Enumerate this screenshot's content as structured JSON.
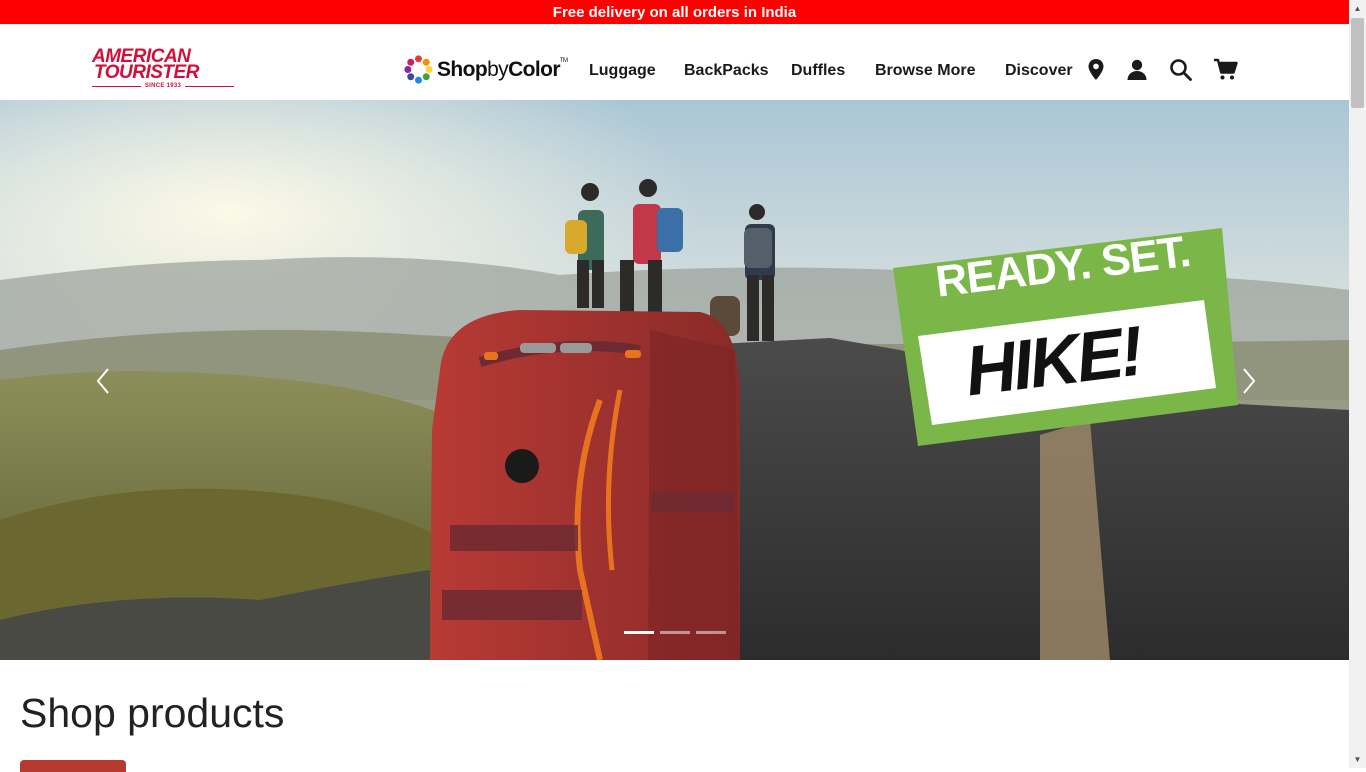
{
  "promo_bar": {
    "text": "Free delivery on all orders in India"
  },
  "header": {
    "logo": {
      "line1": "AMERICAN",
      "line2": "TOURISTER",
      "since": "SINCE 1933"
    },
    "shop_by_color": {
      "shop": "Shop",
      "by": "by",
      "color": "Color",
      "tm": "TM"
    },
    "nav": [
      {
        "label": "Luggage"
      },
      {
        "label": "BackPacks"
      },
      {
        "label": "Duffles"
      },
      {
        "label": "Browse More"
      },
      {
        "label": "Discover"
      }
    ],
    "icons": [
      "location-pin-icon",
      "user-account-icon",
      "search-icon",
      "shopping-cart-icon"
    ]
  },
  "hero": {
    "badge_top": "READY. SET.",
    "badge_bottom": "HIKE!",
    "slides_count": 3,
    "active_slide": 1,
    "brand_colors": {
      "badge_green": "#7ab648",
      "backpack_red": "#a8322f",
      "accent_orange": "#e8731f"
    }
  },
  "main": {
    "section_title": "Shop products"
  },
  "colors": {
    "promo_red": "#ff0000",
    "brand_red": "#d0103a",
    "text_dark": "#1a1a1a"
  }
}
